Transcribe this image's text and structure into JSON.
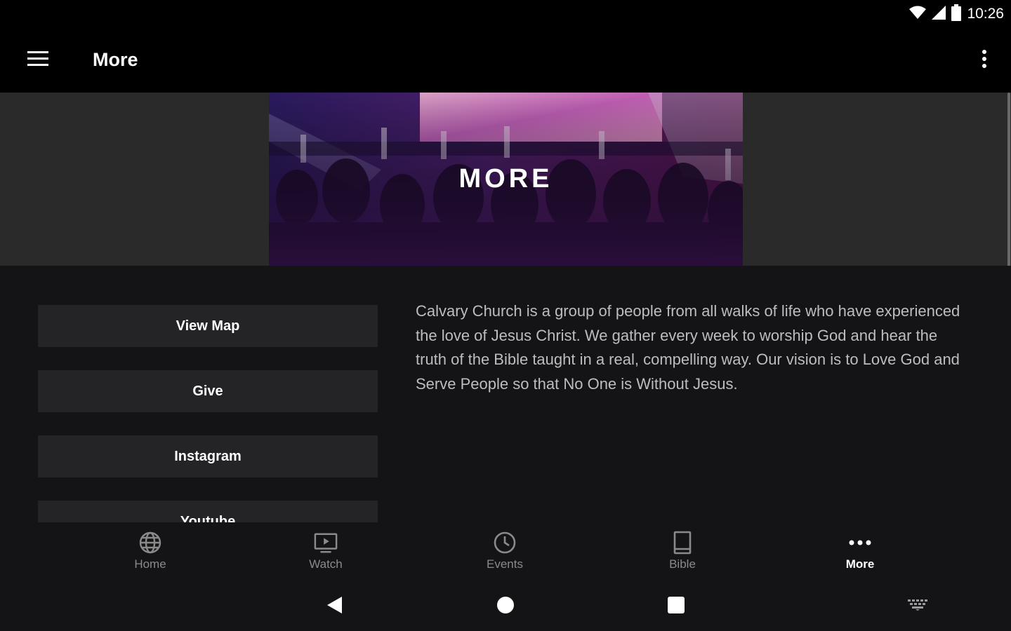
{
  "status_bar": {
    "time": "10:26",
    "icons": [
      "wifi-icon",
      "signal-icon",
      "battery-icon"
    ]
  },
  "app_bar": {
    "title": "More",
    "menu_icon": "hamburger-menu-icon",
    "overflow_icon": "more-vert-icon"
  },
  "banner": {
    "text": "MORE"
  },
  "buttons": [
    {
      "label": "View Map"
    },
    {
      "label": "Give"
    },
    {
      "label": "Instagram"
    },
    {
      "label": "Youtube"
    }
  ],
  "description": "Calvary Church is a group of people from all walks of life who have experienced the love of Jesus Christ. We gather every week to worship God and hear the truth of the Bible taught in a real, compelling way. Our vision is to Love God and Serve People so that No One is Without Jesus.",
  "bottom_nav": {
    "items": [
      {
        "label": "Home",
        "icon": "globe-icon",
        "active": false
      },
      {
        "label": "Watch",
        "icon": "tv-icon",
        "active": false
      },
      {
        "label": "Events",
        "icon": "clock-icon",
        "active": false
      },
      {
        "label": "Bible",
        "icon": "book-icon",
        "active": false
      },
      {
        "label": "More",
        "icon": "more-horiz-icon",
        "active": true
      }
    ]
  },
  "system_nav": {
    "buttons": [
      "back-icon",
      "home-icon",
      "recents-icon",
      "keyboard-icon"
    ]
  },
  "colors": {
    "background": "#141417",
    "button": "#242427",
    "banner_area": "#2a2a2a",
    "inactive_text": "#8a8a8a",
    "body_text": "#bdbdbd"
  }
}
